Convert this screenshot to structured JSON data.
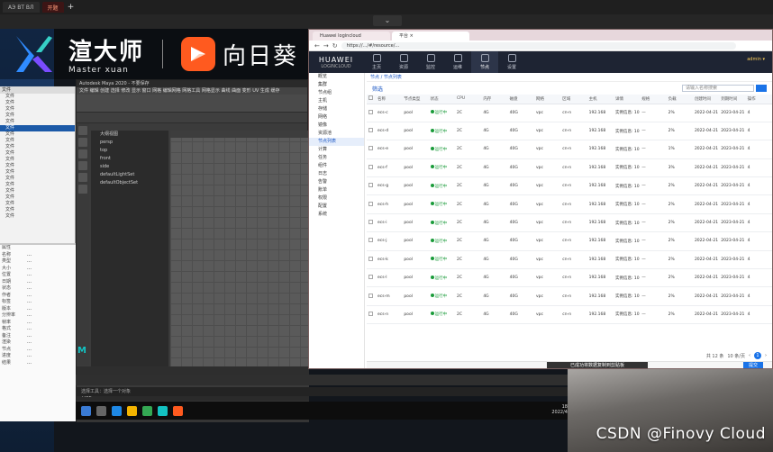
{
  "top_tabs": [
    {
      "label": "АЭ ВТ ВЛ",
      "active": false
    },
    {
      "label": "开题",
      "active": true
    }
  ],
  "new_tab": "+",
  "collapse_glyph": "⌄",
  "banner": {
    "logo_cn": "渲大师",
    "logo_en": "Master xuan",
    "partner": "向日葵"
  },
  "file_panel": {
    "header": "文件",
    "items": [
      "文件",
      "文件",
      "文件",
      "文件",
      "文件",
      "文件",
      "文件",
      "文件",
      "文件",
      "文件",
      "文件",
      "文件",
      "文件",
      "文件",
      "文件",
      "文件",
      "文件",
      "文件",
      "文件",
      "文件"
    ],
    "selected_index": 5
  },
  "prop_panel": {
    "rows": [
      [
        "属性",
        ""
      ],
      [
        "名称",
        "…"
      ],
      [
        "类型",
        "…"
      ],
      [
        "大小",
        "…"
      ],
      [
        "位置",
        "…"
      ],
      [
        "日期",
        "…"
      ],
      [
        "状态",
        "…"
      ],
      [
        "作者",
        "…"
      ],
      [
        "标签",
        "…"
      ],
      [
        "版本",
        "…"
      ],
      [
        "分辨率",
        "…"
      ],
      [
        "帧率",
        "…"
      ],
      [
        "格式",
        "…"
      ],
      [
        "备注",
        "…"
      ],
      [
        "渲染",
        "…"
      ],
      [
        "节点",
        "…"
      ],
      [
        "进度",
        "…"
      ],
      [
        "结果",
        "…"
      ]
    ]
  },
  "maya": {
    "title": "Autodesk Maya 2020 - 不要保存",
    "menu": "文件  编辑  创建  选择  修改  显示  窗口  网格  编辑网格  网格工具  网格显示  曲线  曲面  变形  UV  生成  缓存",
    "outliner": [
      "大纲视图",
      "persp",
      "top",
      "front",
      "side",
      "defaultLightSet",
      "defaultObjectSet"
    ],
    "cmd": "MEL",
    "help": "选择工具：选择一个对象",
    "logo": "M"
  },
  "taskbar": {
    "time": "18:47",
    "date": "2022/4/21"
  },
  "hw": {
    "tabs": [
      {
        "label": "Huawei logincloud",
        "active": false
      },
      {
        "label": "平台 ×",
        "active": true
      }
    ],
    "url": "https://…/#/resource/…",
    "logo_top": "HUAWEI",
    "logo_bot": "LOGINCLOUD",
    "nav": [
      {
        "label": "主页",
        "active": false
      },
      {
        "label": "资源",
        "active": false
      },
      {
        "label": "监控",
        "active": false
      },
      {
        "label": "运维",
        "active": false
      },
      {
        "label": "节点",
        "active": true
      },
      {
        "label": "设置",
        "active": false
      }
    ],
    "user": "admin ▾",
    "side": [
      {
        "label": "概览",
        "sel": false
      },
      {
        "label": "集群",
        "sel": false
      },
      {
        "label": "节点组",
        "sel": false
      },
      {
        "label": "主机",
        "sel": false
      },
      {
        "label": "存储",
        "sel": false
      },
      {
        "label": "网络",
        "sel": false
      },
      {
        "label": "镜像",
        "sel": false
      },
      {
        "label": "资源池",
        "sel": false
      },
      {
        "label": "节点列表",
        "sel": true
      },
      {
        "label": "计算",
        "sel": false
      },
      {
        "label": "任务",
        "sel": false
      },
      {
        "label": "组件",
        "sel": false
      },
      {
        "label": "日志",
        "sel": false
      },
      {
        "label": "告警",
        "sel": false
      },
      {
        "label": "账单",
        "sel": false
      },
      {
        "label": "权限",
        "sel": false
      },
      {
        "label": "配置",
        "sel": false
      },
      {
        "label": "系统",
        "sel": false
      }
    ],
    "breadcrumb": "节点 / 节点列表",
    "filter_label": "筛选",
    "search_placeholder": "请输入名称搜索",
    "columns": [
      "名称",
      "节点类型",
      "状态",
      "CPU",
      "内存",
      "磁盘",
      "网络",
      "区域",
      "主机",
      "详情",
      "规格",
      "负载",
      "创建时间",
      "到期时间",
      "操作"
    ],
    "rows": [
      {
        "name": "ecs-c",
        "type": "pool",
        "status": "运行中",
        "c": "2C",
        "m": "4G",
        "d": "40G",
        "n": "vpc",
        "r": "cn-n",
        "h": "192.168",
        "det": "实例信息: 10.0.1.",
        "spec": "—",
        "load": "2%",
        "ct": "2022-04-21",
        "et": "2023-04-21",
        "op": "4"
      },
      {
        "name": "ecs-d",
        "type": "pool",
        "status": "运行中",
        "c": "2C",
        "m": "4G",
        "d": "40G",
        "n": "vpc",
        "r": "cn-n",
        "h": "192.168",
        "det": "实例信息: 10.0.1.",
        "spec": "—",
        "load": "2%",
        "ct": "2022-04-21",
        "et": "2023-04-21",
        "op": "4"
      },
      {
        "name": "ecs-e",
        "type": "pool",
        "status": "运行中",
        "c": "2C",
        "m": "4G",
        "d": "40G",
        "n": "vpc",
        "r": "cn-n",
        "h": "192.168",
        "det": "实例信息: 10.0.1.",
        "spec": "—",
        "load": "1%",
        "ct": "2022-04-21",
        "et": "2023-04-21",
        "op": "4"
      },
      {
        "name": "ecs-f",
        "type": "pool",
        "status": "运行中",
        "c": "2C",
        "m": "4G",
        "d": "40G",
        "n": "vpc",
        "r": "cn-n",
        "h": "192.168",
        "det": "实例信息: 10.0.1.",
        "spec": "—",
        "load": "3%",
        "ct": "2022-04-21",
        "et": "2023-04-21",
        "op": "4"
      },
      {
        "name": "ecs-g",
        "type": "pool",
        "status": "运行中",
        "c": "2C",
        "m": "4G",
        "d": "40G",
        "n": "vpc",
        "r": "cn-n",
        "h": "192.168",
        "det": "实例信息: 10.0.1.",
        "spec": "—",
        "load": "2%",
        "ct": "2022-04-21",
        "et": "2023-04-21",
        "op": "4"
      },
      {
        "name": "ecs-h",
        "type": "pool",
        "status": "运行中",
        "c": "2C",
        "m": "4G",
        "d": "40G",
        "n": "vpc",
        "r": "cn-n",
        "h": "192.168",
        "det": "实例信息: 10.0.1.",
        "spec": "—",
        "load": "2%",
        "ct": "2022-04-21",
        "et": "2023-04-21",
        "op": "4"
      },
      {
        "name": "ecs-i",
        "type": "pool",
        "status": "运行中",
        "c": "2C",
        "m": "4G",
        "d": "40G",
        "n": "vpc",
        "r": "cn-n",
        "h": "192.168",
        "det": "实例信息: 10.0.1.",
        "spec": "—",
        "load": "2%",
        "ct": "2022-04-21",
        "et": "2023-04-21",
        "op": "4"
      },
      {
        "name": "ecs-j",
        "type": "pool",
        "status": "运行中",
        "c": "2C",
        "m": "4G",
        "d": "40G",
        "n": "vpc",
        "r": "cn-n",
        "h": "192.168",
        "det": "实例信息: 10.0.1.",
        "spec": "—",
        "load": "2%",
        "ct": "2022-04-21",
        "et": "2023-04-21",
        "op": "4"
      },
      {
        "name": "ecs-k",
        "type": "pool",
        "status": "运行中",
        "c": "2C",
        "m": "4G",
        "d": "40G",
        "n": "vpc",
        "r": "cn-n",
        "h": "192.168",
        "det": "实例信息: 10.0.1.",
        "spec": "—",
        "load": "2%",
        "ct": "2022-04-21",
        "et": "2023-04-21",
        "op": "4"
      },
      {
        "name": "ecs-l",
        "type": "pool",
        "status": "运行中",
        "c": "2C",
        "m": "4G",
        "d": "40G",
        "n": "vpc",
        "r": "cn-n",
        "h": "192.168",
        "det": "实例信息: 10.0.1.",
        "spec": "—",
        "load": "2%",
        "ct": "2022-04-21",
        "et": "2023-04-21",
        "op": "4"
      },
      {
        "name": "ecs-m",
        "type": "pool",
        "status": "运行中",
        "c": "2C",
        "m": "4G",
        "d": "40G",
        "n": "vpc",
        "r": "cn-n",
        "h": "192.168",
        "det": "实例信息: 10.0.1.",
        "spec": "—",
        "load": "2%",
        "ct": "2022-04-21",
        "et": "2023-04-21",
        "op": "4"
      },
      {
        "name": "ecs-n",
        "type": "pool",
        "status": "运行中",
        "c": "2C",
        "m": "4G",
        "d": "40G",
        "n": "vpc",
        "r": "cn-n",
        "h": "192.168",
        "det": "实例信息: 10.0.1.",
        "spec": "—",
        "load": "2%",
        "ct": "2022-04-21",
        "et": "2023-04-21",
        "op": "4"
      }
    ],
    "pager": {
      "total": "共 12 条",
      "size": "10 条/页",
      "current": "1"
    },
    "tooltip": "已成功将数据复制到剪贴板",
    "submit": "提交"
  },
  "watermark": "CSDN @Finovy Cloud"
}
